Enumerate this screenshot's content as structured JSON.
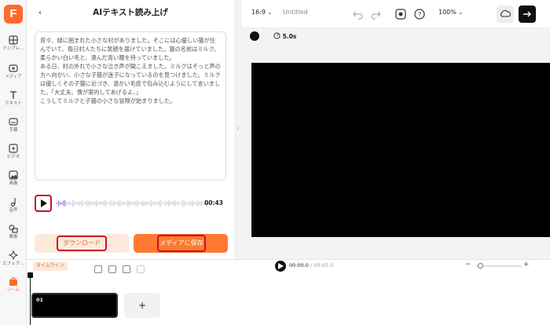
{
  "rail": {
    "logo": "F",
    "items": [
      {
        "label": "テンプレ…",
        "icon": "template-icon"
      },
      {
        "label": "メディア",
        "icon": "media-icon"
      },
      {
        "label": "テキスト",
        "icon": "text-icon"
      },
      {
        "label": "字幕",
        "icon": "caption-icon"
      },
      {
        "label": "ビデオ",
        "icon": "video-icon"
      },
      {
        "label": "画像",
        "icon": "image-icon"
      },
      {
        "label": "音声",
        "icon": "audio-icon"
      },
      {
        "label": "要素",
        "icon": "elements-icon"
      },
      {
        "label": "エフェク…",
        "icon": "effects-icon"
      },
      {
        "label": "ツール",
        "icon": "tools-icon"
      }
    ]
  },
  "panel": {
    "title": "AIテキスト読み上げ",
    "text": "昔々、緑に囲まれた小さな村がありました。そこには心優しい猫が住んでいて、毎日村人たちに笑顔を届けていました。猫の名前はミルク。柔らかい白い毛と、澄んだ青い瞳を持っていました。\nある日、村の外れで小さな泣き声が聞こえました。ミルクはそっと声の方へ向かい、小さな子猫が迷子になっているのを見つけました。ミルクは優しくその子猫に近づき、温かい毛皮で包み込むようにして言いました。「大丈夫、僕が案内してあげるよ。」\nこうしてミルクと子猫の小さな冒険が始まりました。",
    "duration": "00:43",
    "download_label": "ダウンロード",
    "save_label": "メディアに保存"
  },
  "topbar": {
    "ratio": "16:9",
    "title": "Untitled",
    "zoom": "100%"
  },
  "preview": {
    "duration": "5.0s"
  },
  "timeline": {
    "tag": "タイムライン",
    "current": "00:00.0",
    "total": "/ 00:05.0",
    "clip_number": "01",
    "add_label": "+"
  },
  "colors": {
    "accent": "#ff7a30",
    "highlight": "#c8102e"
  }
}
